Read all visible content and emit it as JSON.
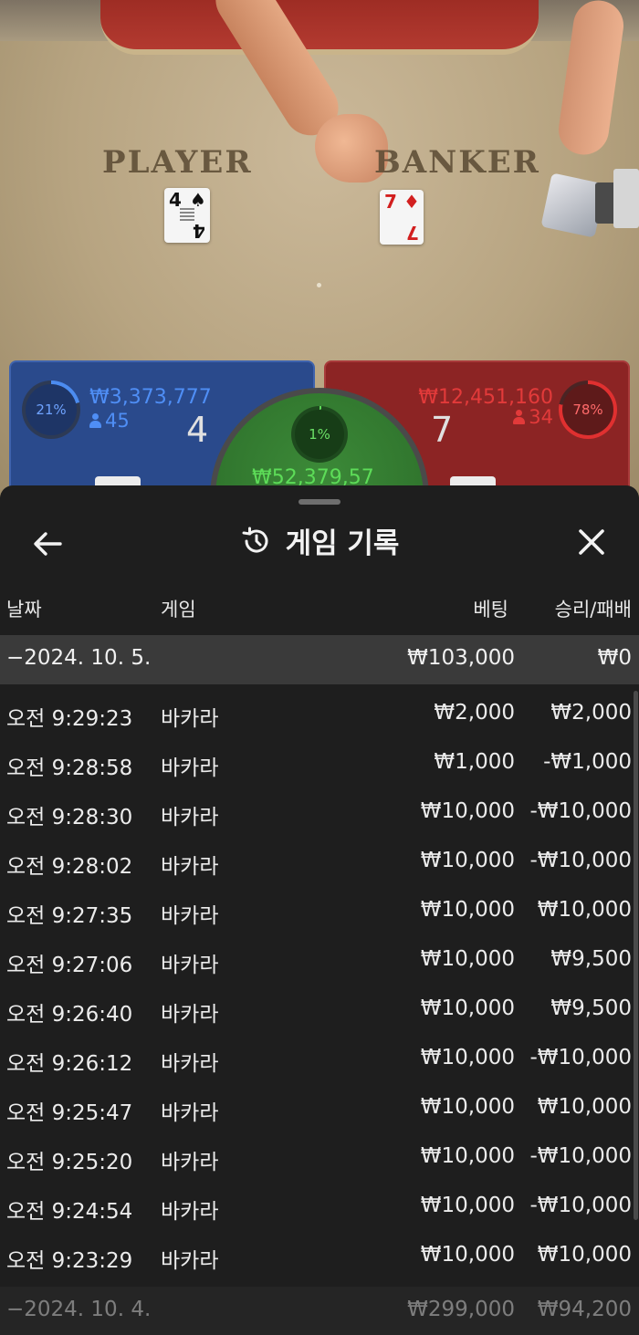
{
  "table": {
    "player_label": "PLAYER",
    "banker_label": "BANKER",
    "player_card": {
      "rank": "4",
      "suit": "♠"
    },
    "banker_card": {
      "rank": "7",
      "suit": "♦"
    }
  },
  "scoreboard": {
    "player": {
      "percent": "21%",
      "amount": "₩3,373,777",
      "count": "45",
      "score": "4",
      "color": "#2a4a8c"
    },
    "banker": {
      "percent": "78%",
      "amount": "₩12,451,160",
      "count": "34",
      "score": "7",
      "color": "#8c2424"
    },
    "tie": {
      "percent": "1%",
      "amount": "₩52,379,57",
      "color": "#3c8a38"
    }
  },
  "history": {
    "title": "게임 기록",
    "icons": {
      "back": "arrow-left-icon",
      "close": "close-icon",
      "title": "history-clock-icon"
    },
    "columns": {
      "date": "날짜",
      "game": "게임",
      "bet": "베팅",
      "result": "승리/패배"
    },
    "groups": [
      {
        "date": "−2024. 10. 5.",
        "total_bet": "₩103,000",
        "total_result": "₩0",
        "rows": [
          {
            "time": "오전 9:29:23",
            "game": "바카라",
            "bet": "₩2,000",
            "result": "₩2,000"
          },
          {
            "time": "오전 9:28:58",
            "game": "바카라",
            "bet": "₩1,000",
            "result": "-₩1,000"
          },
          {
            "time": "오전 9:28:30",
            "game": "바카라",
            "bet": "₩10,000",
            "result": "-₩10,000"
          },
          {
            "time": "오전 9:28:02",
            "game": "바카라",
            "bet": "₩10,000",
            "result": "-₩10,000"
          },
          {
            "time": "오전 9:27:35",
            "game": "바카라",
            "bet": "₩10,000",
            "result": "₩10,000"
          },
          {
            "time": "오전 9:27:06",
            "game": "바카라",
            "bet": "₩10,000",
            "result": "₩9,500"
          },
          {
            "time": "오전 9:26:40",
            "game": "바카라",
            "bet": "₩10,000",
            "result": "₩9,500"
          },
          {
            "time": "오전 9:26:12",
            "game": "바카라",
            "bet": "₩10,000",
            "result": "-₩10,000"
          },
          {
            "time": "오전 9:25:47",
            "game": "바카라",
            "bet": "₩10,000",
            "result": "₩10,000"
          },
          {
            "time": "오전 9:25:20",
            "game": "바카라",
            "bet": "₩10,000",
            "result": "-₩10,000"
          },
          {
            "time": "오전 9:24:54",
            "game": "바카라",
            "bet": "₩10,000",
            "result": "-₩10,000"
          },
          {
            "time": "오전 9:23:29",
            "game": "바카라",
            "bet": "₩10,000",
            "result": "₩10,000"
          }
        ]
      },
      {
        "date": "−2024. 10. 4.",
        "total_bet": "₩299,000",
        "total_result": "₩94,200",
        "rows": []
      }
    ]
  }
}
